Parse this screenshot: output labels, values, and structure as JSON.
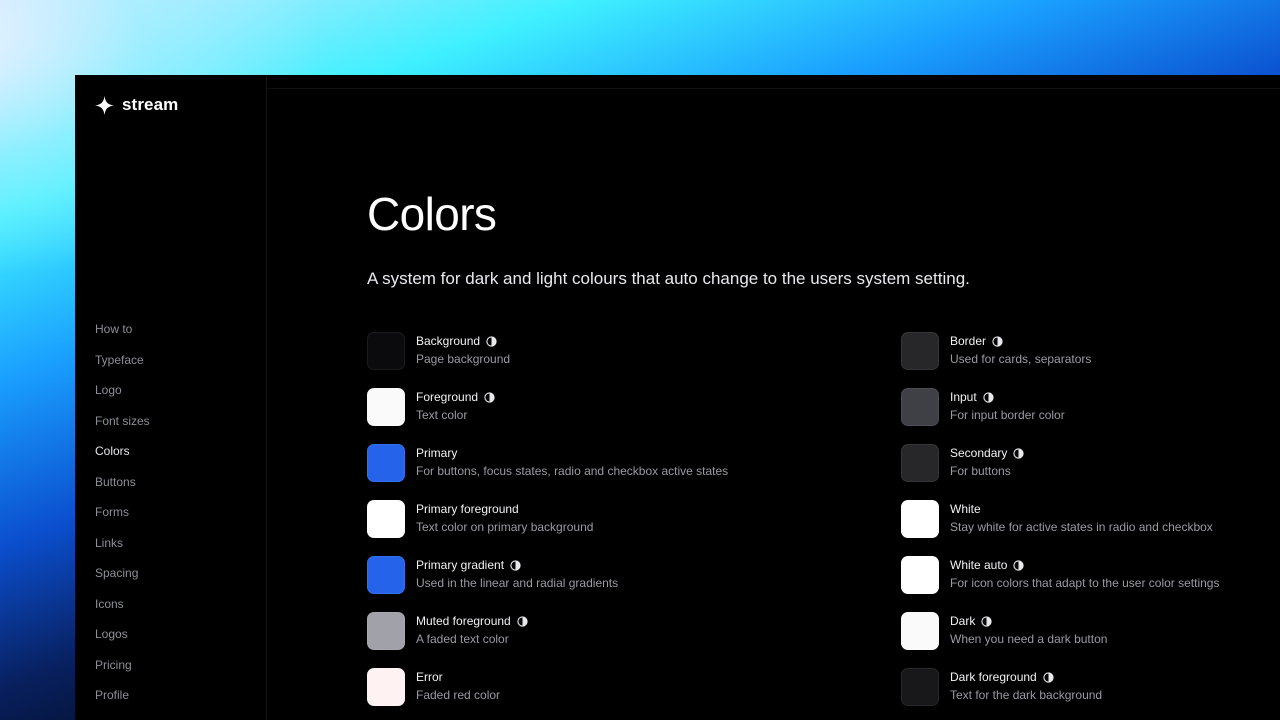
{
  "app": {
    "name": "stream"
  },
  "sidebar": {
    "items": [
      {
        "label": "How to",
        "active": false
      },
      {
        "label": "Typeface",
        "active": false
      },
      {
        "label": "Logo",
        "active": false
      },
      {
        "label": "Font sizes",
        "active": false
      },
      {
        "label": "Colors",
        "active": true
      },
      {
        "label": "Buttons",
        "active": false
      },
      {
        "label": "Forms",
        "active": false
      },
      {
        "label": "Links",
        "active": false
      },
      {
        "label": "Spacing",
        "active": false
      },
      {
        "label": "Icons",
        "active": false
      },
      {
        "label": "Logos",
        "active": false
      },
      {
        "label": "Pricing",
        "active": false
      },
      {
        "label": "Profile",
        "active": false
      }
    ]
  },
  "page": {
    "title": "Colors",
    "subtitle": "A system for dark and light colours that auto change to the users system setting."
  },
  "colors_left": [
    {
      "name": "Background",
      "desc": "Page background",
      "color": "#0b0b0e",
      "adaptive": true
    },
    {
      "name": "Foreground",
      "desc": "Text color",
      "color": "#fafafa",
      "adaptive": true
    },
    {
      "name": "Primary",
      "desc": "For buttons, focus states, radio and checkbox active states",
      "color": "#2563eb",
      "adaptive": false
    },
    {
      "name": "Primary foreground",
      "desc": "Text color on primary background",
      "color": "#ffffff",
      "adaptive": false
    },
    {
      "name": "Primary gradient",
      "desc": "Used in the linear and radial gradients",
      "color": "#2563eb",
      "adaptive": true
    },
    {
      "name": "Muted foreground",
      "desc": "A faded text color",
      "color": "#a1a1aa",
      "adaptive": true
    },
    {
      "name": "Error",
      "desc": "Faded red color",
      "color": "#fef2f2",
      "adaptive": false
    }
  ],
  "colors_right": [
    {
      "name": "Border",
      "desc": "Used for cards, separators",
      "color": "#27272a",
      "adaptive": true
    },
    {
      "name": "Input",
      "desc": "For input border color",
      "color": "#3f3f46",
      "adaptive": true
    },
    {
      "name": "Secondary",
      "desc": "For buttons",
      "color": "#27272a",
      "adaptive": true
    },
    {
      "name": "White",
      "desc": "Stay white for active states in radio and checkbox",
      "color": "#ffffff",
      "adaptive": false
    },
    {
      "name": "White auto",
      "desc": "For icon colors that adapt to the user color settings",
      "color": "#ffffff",
      "adaptive": true
    },
    {
      "name": "Dark",
      "desc": "When you need a dark button",
      "color": "#fafafa",
      "adaptive": true
    },
    {
      "name": "Dark foreground",
      "desc": "Text for the dark background",
      "color": "#18181b",
      "adaptive": true
    }
  ],
  "icons": {
    "brand": "sparkle-icon",
    "adaptive": "contrast-icon"
  },
  "theme": {
    "accent": "#2563eb",
    "active_nav": "#e6e6ea",
    "muted_text": "#9a9ba2"
  }
}
